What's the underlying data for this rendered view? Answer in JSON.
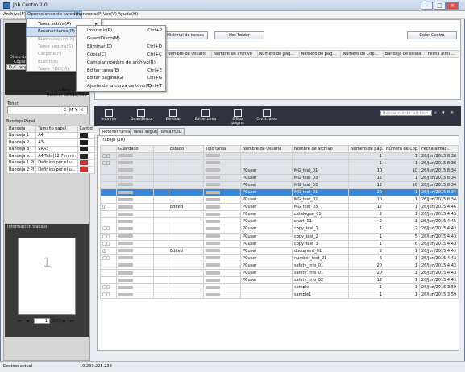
{
  "app": {
    "title": "Job Centro 2.0"
  },
  "menubar": [
    "Archivo(F)",
    "Operaciones de tarea(J)",
    "Impresora(P)",
    "Ver(V)",
    "Ayuda(H)"
  ],
  "dropdown": {
    "items": [
      {
        "label": "Tarea activa(A)",
        "disabled": false,
        "arrow": true
      },
      {
        "label": "Retener tarea(R)",
        "disabled": false,
        "arrow": true,
        "highlight": true
      },
      {
        "label": "Buzón seguro(X)",
        "disabled": true,
        "arrow": true
      },
      {
        "label": "Tarea segura(S)",
        "disabled": true,
        "arrow": true
      },
      {
        "label": "Carpeta(F)",
        "disabled": true,
        "arrow": true
      },
      {
        "label": "Buzón(B)",
        "disabled": true,
        "arrow": true
      },
      {
        "label": "Tarea HDD(M)",
        "disabled": true,
        "arrow": true
      }
    ]
  },
  "submenu": {
    "items": [
      {
        "label": "Imprimir(P)",
        "key": "Ctrl+P"
      },
      {
        "label": "GuardDisco(M)",
        "key": ""
      },
      {
        "label": "Eliminar(D)",
        "key": "Ctrl+D"
      },
      {
        "label": "Copia(C)",
        "key": "Ctrl+C"
      },
      {
        "label": "Cambiar nombre de archivo(R)",
        "key": ""
      },
      {
        "label": "Editar tarea(E)",
        "key": "Ctrl+E"
      },
      {
        "label": "Editar página(G)",
        "key": "Ctrl+G"
      },
      {
        "label": "Ajuste de la curva de tono(T)",
        "key": "Ctrl+T"
      }
    ]
  },
  "left": {
    "disco_label": "Disco duro",
    "copia_label": "Copia",
    "dd_label": "D.d. propi./d. acc./form.",
    "libre_label": "Libre:",
    "libre_val": "0%",
    "retener_label": "Retener tarea:",
    "retener_val": "10/500",
    "toner_label": "Tóner",
    "toner_letters": [
      "C",
      "M",
      "Y",
      "K"
    ],
    "bandeja_title": "Bandeja Papel",
    "bandeja_headers": [
      "Bandeja",
      "Tamaño papel",
      "Cantid"
    ],
    "bandeja_rows": [
      {
        "tray": "Bandeja 1",
        "size": "A4"
      },
      {
        "tray": "Bandeja 2",
        "size": "A3"
      },
      {
        "tray": "Bandeja 3",
        "size": "SRA3"
      },
      {
        "tray": "Bandeja e...",
        "size": "A4 Tab (12.7 mm)"
      },
      {
        "tray": "Bandeja 1 PI",
        "size": "Definido por el u..."
      },
      {
        "tray": "Bandeja 2 PI",
        "size": "Definido por el u..."
      }
    ],
    "info_title": "Información trabajo",
    "preview_number": "1",
    "page_input": "1",
    "page_total": "/2(0)"
  },
  "top": {
    "buttons": [
      "Historial de tareas",
      "Hot Folder",
      "Color Centro"
    ],
    "headers": [
      "Nombre de Usuario",
      "Nombre de archivo",
      "Número de pág...",
      "Número de pág...",
      "Número de Cop...",
      "Bandeja de salida",
      "Fecha alma..."
    ]
  },
  "toolbar": [
    "Imprimir",
    "GuardDisco",
    "Eliminar",
    "Editar tarea",
    "Editar página",
    "Crv.tt.tarea"
  ],
  "search_placeholder": "Buscar nombr. archivo",
  "tabs": [
    "Retener tarea",
    "Tarea segura",
    "Tarea HDD"
  ],
  "trabajo_label": "Trabajo (10)",
  "job_headers": [
    "",
    "Guardado",
    "",
    "Estado",
    "Tipo tarea",
    "Nombre de Usuario",
    "Nombre de archivo",
    "Número de pág...",
    "Número de Cop...",
    "Fecha almac..."
  ],
  "jobs": [
    {
      "g": "grey",
      "icon": "□□",
      "estado": "",
      "user": "",
      "file": "",
      "pages": "1",
      "copies": "1",
      "date": "26/Jun/2015 8:36"
    },
    {
      "g": "grey",
      "icon": "□□",
      "estado": "",
      "user": "",
      "file": "",
      "pages": "1",
      "copies": "1",
      "date": "26/Jun/2015 8:36"
    },
    {
      "g": "grey",
      "icon": "",
      "estado": "",
      "user": "PCuser",
      "file": "MG_test_01",
      "pages": "10",
      "copies": "10",
      "date": "26/Jun/2015 8:34"
    },
    {
      "g": "grey",
      "icon": "",
      "estado": "",
      "user": "PCuser",
      "file": "MG_test_03",
      "pages": "12",
      "copies": "1",
      "date": "26/Jun/2015 8:34"
    },
    {
      "g": "grey",
      "icon": "",
      "estado": "",
      "user": "PCuser",
      "file": "MG_test_03",
      "pages": "12",
      "copies": "10",
      "date": "26/Jun/2015 8:34"
    },
    {
      "g": "sel",
      "icon": "",
      "estado": "",
      "user": "PCuser",
      "file": "MG_test_01",
      "pages": "20",
      "copies": "1",
      "date": "26/Jun/2015 8:34"
    },
    {
      "g": "",
      "icon": "",
      "estado": "",
      "user": "PCuser",
      "file": "MG_test_02",
      "pages": "10",
      "copies": "1",
      "date": "26/Jun/2015 8:34"
    },
    {
      "g": "",
      "icon": "◫",
      "estado": "Edited",
      "user": "PCuser",
      "file": "MG_test_03",
      "pages": "12",
      "copies": "1",
      "date": "26/Jun/2015 4:46"
    },
    {
      "g": "",
      "icon": "",
      "estado": "",
      "user": "PCuser",
      "file": "catalogue_01",
      "pages": "2",
      "copies": "1",
      "date": "26/Jun/2015 4:45"
    },
    {
      "g": "",
      "icon": "",
      "estado": "",
      "user": "PCuser",
      "file": "chart_01",
      "pages": "2",
      "copies": "1",
      "date": "26/Jun/2015 4:45"
    },
    {
      "g": "",
      "icon": "□□",
      "estado": "",
      "user": "PCuser",
      "file": "copy_test_1",
      "pages": "1",
      "copies": "2",
      "date": "26/Jun/2015 4:43"
    },
    {
      "g": "",
      "icon": "□□",
      "estado": "",
      "user": "PCuser",
      "file": "copy_test_2",
      "pages": "1",
      "copies": "5",
      "date": "26/Jun/2015 4:43"
    },
    {
      "g": "",
      "icon": "□□",
      "estado": "",
      "user": "PCuser",
      "file": "copy_test_3",
      "pages": "1",
      "copies": "6",
      "date": "26/Jun/2015 4:43"
    },
    {
      "g": "",
      "icon": "◫",
      "estado": "Edited",
      "user": "PCuser",
      "file": "document_01",
      "pages": "2",
      "copies": "1",
      "date": "26/Jun/2015 4:43"
    },
    {
      "g": "",
      "icon": "□□",
      "estado": "",
      "user": "PCuser",
      "file": "number_test_01",
      "pages": "6",
      "copies": "1",
      "date": "26/Jun/2015 4:43"
    },
    {
      "g": "",
      "icon": "",
      "estado": "",
      "user": "PCuser",
      "file": "safety_info_01",
      "pages": "20",
      "copies": "1",
      "date": "26/Jun/2015 4:43"
    },
    {
      "g": "",
      "icon": "",
      "estado": "",
      "user": "PCuser",
      "file": "safety_info_01",
      "pages": "20",
      "copies": "1",
      "date": "26/Jun/2015 4:43"
    },
    {
      "g": "",
      "icon": "",
      "estado": "",
      "user": "PCuser",
      "file": "safety_info_02",
      "pages": "12",
      "copies": "1",
      "date": "26/Jun/2015 4:43"
    },
    {
      "g": "",
      "icon": "□□",
      "estado": "",
      "user": "",
      "file": "sample",
      "pages": "1",
      "copies": "1",
      "date": "26/Jun/2015 3:59"
    },
    {
      "g": "",
      "icon": "□□",
      "estado": "",
      "user": "",
      "file": "sample1",
      "pages": "1",
      "copies": "1",
      "date": "26/Jun/2015 3:59"
    }
  ],
  "status": {
    "label": "Destino actual",
    "ip": "10.239.225.238"
  }
}
